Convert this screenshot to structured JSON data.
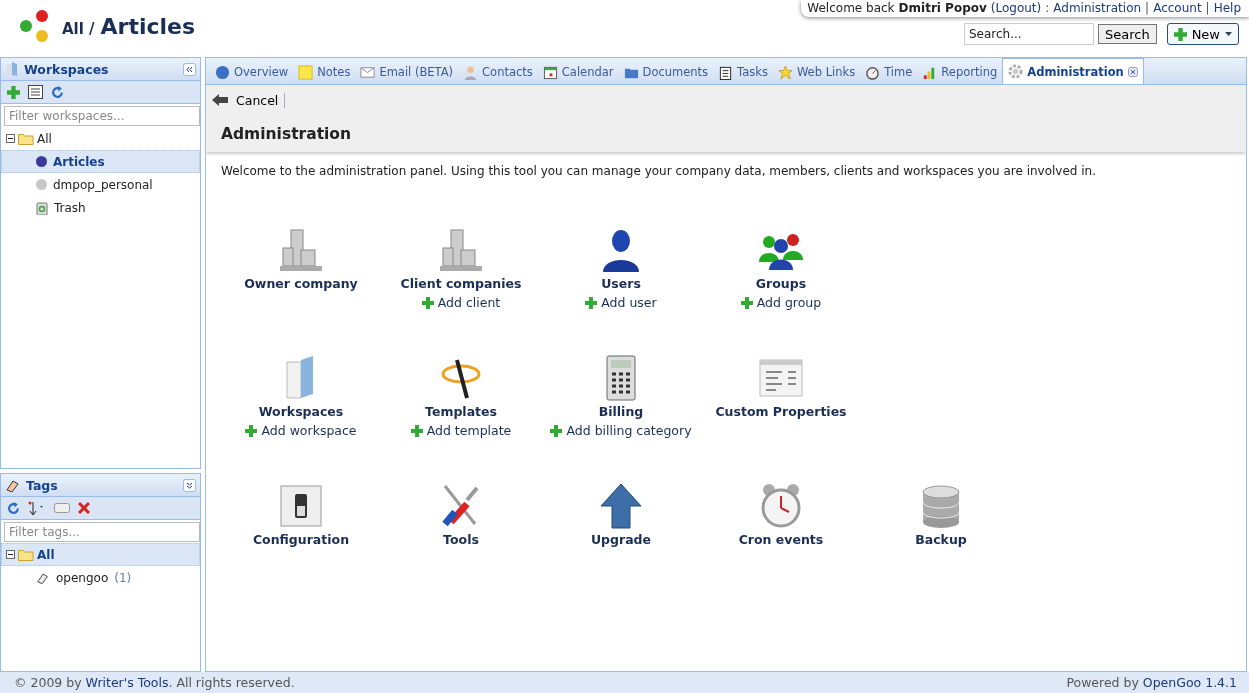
{
  "header": {
    "breadcrumb_parent": "All /",
    "breadcrumb_current": "Articles"
  },
  "user_bar": {
    "greeting": "Welcome back",
    "user": "Dmitri Popov",
    "parts": [
      {
        "text": "(Logout)",
        "kind": "link"
      },
      {
        "text": ":",
        "kind": "sep"
      },
      {
        "text": "Administration",
        "kind": "link"
      },
      {
        "text": "|",
        "kind": "sep"
      },
      {
        "text": "Account",
        "kind": "link"
      },
      {
        "text": "|",
        "kind": "sep"
      },
      {
        "text": "Help",
        "kind": "link"
      }
    ]
  },
  "search": {
    "placeholder": "Search...",
    "button": "Search"
  },
  "new_button": "New",
  "workspaces": {
    "title": "Workspaces",
    "filter_placeholder": "Filter workspaces...",
    "tree": [
      {
        "label": "All",
        "kind": "folder",
        "expanded": true,
        "selected": false,
        "children": [
          {
            "label": "Articles",
            "kind": "dot",
            "color": "#3a3a9a",
            "selected": true
          },
          {
            "label": "dmpop_personal",
            "kind": "dot",
            "color": "#c8c8c8",
            "selected": false
          },
          {
            "label": "Trash",
            "kind": "trash",
            "selected": false
          }
        ]
      }
    ]
  },
  "tags": {
    "title": "Tags",
    "filter_placeholder": "Filter tags...",
    "tree": [
      {
        "label": "All",
        "kind": "folder",
        "expanded": true,
        "selected": true,
        "children": [
          {
            "label": "opengoo",
            "count": "(1)",
            "kind": "tag",
            "selected": false
          }
        ]
      }
    ]
  },
  "tabs": [
    {
      "label": "Overview",
      "kind": "globe",
      "selected": false
    },
    {
      "label": "Notes",
      "kind": "note",
      "selected": false
    },
    {
      "label": "Email (BETA)",
      "kind": "mail",
      "selected": false
    },
    {
      "label": "Contacts",
      "kind": "person",
      "selected": false
    },
    {
      "label": "Calendar",
      "kind": "calendar",
      "selected": false
    },
    {
      "label": "Documents",
      "kind": "docs",
      "selected": false
    },
    {
      "label": "Tasks",
      "kind": "clipboard",
      "selected": false
    },
    {
      "label": "Web Links",
      "kind": "star",
      "selected": false
    },
    {
      "label": "Time",
      "kind": "clock",
      "selected": false
    },
    {
      "label": "Reporting",
      "kind": "bars",
      "selected": false
    },
    {
      "label": "Administration",
      "kind": "gear",
      "selected": true
    }
  ],
  "toolbar": {
    "cancel": "Cancel"
  },
  "page": {
    "title": "Administration",
    "intro": "Welcome to the administration panel. Using this tool you can manage your company data, members, clients and workspaces you are involved in.",
    "rows": [
      [
        {
          "title": "Owner company",
          "kind": "building"
        },
        {
          "title": "Client companies",
          "kind": "building",
          "action": "Add client"
        },
        {
          "title": "Users",
          "kind": "user",
          "action": "Add user"
        },
        {
          "title": "Groups",
          "kind": "group",
          "action": "Add group"
        }
      ],
      [
        {
          "title": "Workspaces",
          "kind": "folder",
          "action": "Add workspace"
        },
        {
          "title": "Templates",
          "kind": "wand",
          "action": "Add template"
        },
        {
          "title": "Billing",
          "kind": "calculator",
          "action": "Add billing category"
        },
        {
          "title": "Custom Properties",
          "kind": "form"
        }
      ],
      [
        {
          "title": "Configuration",
          "kind": "switch"
        },
        {
          "title": "Tools",
          "kind": "tools"
        },
        {
          "title": "Upgrade",
          "kind": "arrow"
        },
        {
          "title": "Cron events",
          "kind": "alarm"
        },
        {
          "title": "Backup",
          "kind": "database"
        }
      ]
    ]
  },
  "footer": {
    "copyright_prefix": "© 2009 by",
    "company": "Writer's Tools",
    "copyright_suffix": ". All rights reserved.",
    "powered_prefix": "Powered by",
    "product": "OpenGoo 1.4.1"
  }
}
